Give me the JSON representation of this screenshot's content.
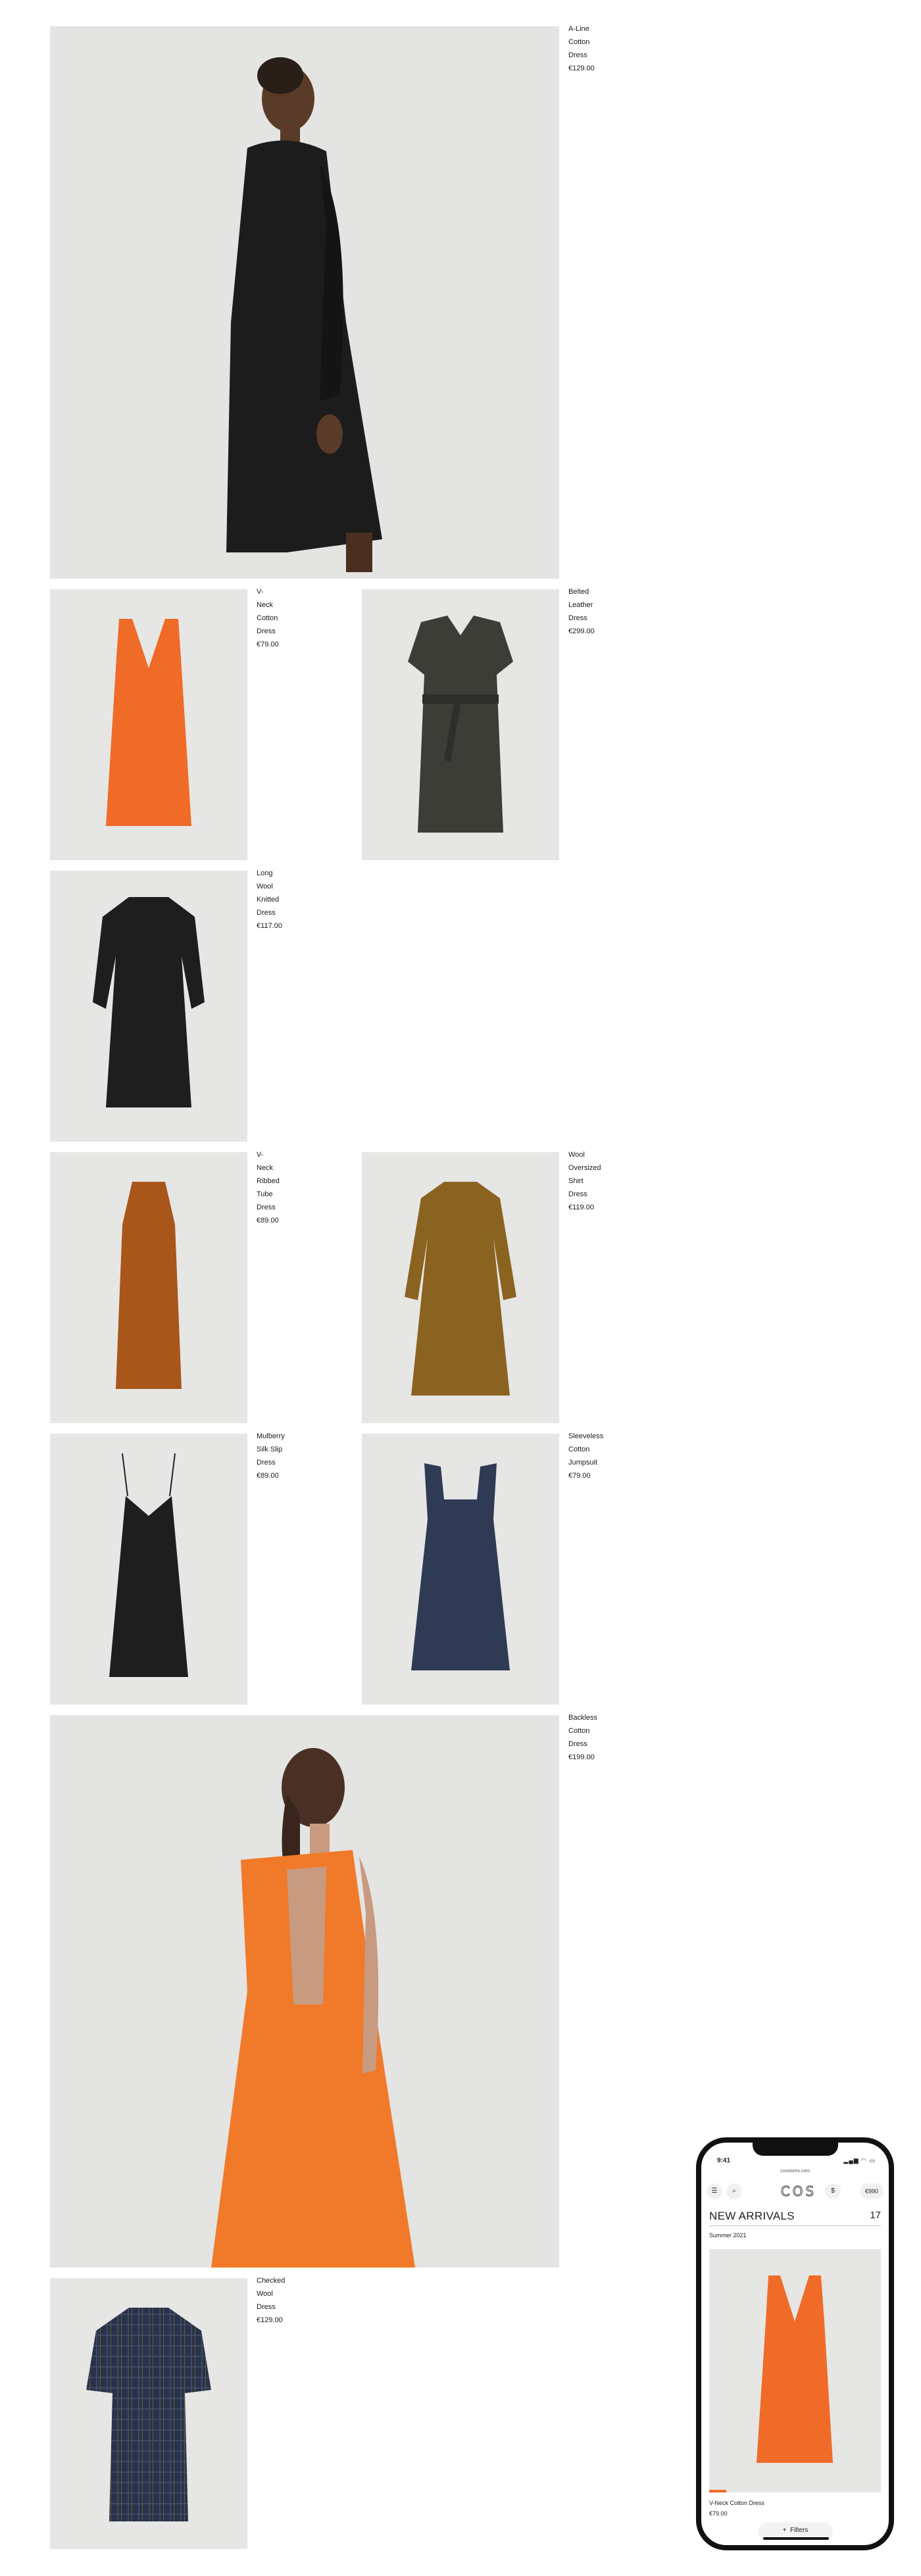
{
  "products": [
    {
      "name": "A-Line Cotton Dress",
      "price": "€129.00",
      "swatches": [
        "#1a1a1a",
        "#8a4d1c"
      ]
    },
    {
      "name": "V-Neck Cotton Dress",
      "price": "€79.00",
      "swatches": [
        "#f06b28"
      ]
    },
    {
      "name": "Belted Leather Dress",
      "price": "€299.00",
      "swatches": [
        "#3d3d38"
      ]
    },
    {
      "name": "Long Wool Knitted Dress",
      "price": "€117.00",
      "swatches": [
        "#222222"
      ]
    },
    {
      "name": "V-Neck Ribbed Tube Dress",
      "price": "€89.00",
      "swatches": [
        "#b4601a"
      ]
    },
    {
      "name": "Wool Oversized Shirt Dress",
      "price": "€119.00",
      "swatches": [
        "#8a6320",
        "#2a2a2a"
      ]
    },
    {
      "name": "Mulberry Silk Slip Dress",
      "price": "€89.00",
      "swatches": [
        "#222222"
      ]
    },
    {
      "name": "Sleeveless Cotton Jumpsuit",
      "price": "€79.00",
      "swatches": [
        "#2f3a55"
      ]
    },
    {
      "name": "Backless Cotton Dress",
      "price": "€199.00",
      "swatches": [
        "#f06b28"
      ]
    },
    {
      "name": "Checked Wool Dress",
      "price": "€129.00",
      "swatches": [
        "#2a3450"
      ]
    }
  ],
  "phone": {
    "time": "9:41",
    "status": "▂▄▆ ◠ ▭",
    "url": "cosstores.com",
    "menu_icon": "☰",
    "search_icon": "⌕",
    "logo": "COS",
    "bag_icon": "$",
    "bag_total": "€990",
    "title": "NEW ARRIVALS",
    "count": "17",
    "subtitle": "Summer 2021",
    "product_name": "V-Neck Cotton Dress",
    "product_price": "€79.00",
    "filters_label": "Filters",
    "filters_icon": "+"
  },
  "colors": {
    "orange": "#f06b28",
    "background": "#e6e6e4"
  }
}
